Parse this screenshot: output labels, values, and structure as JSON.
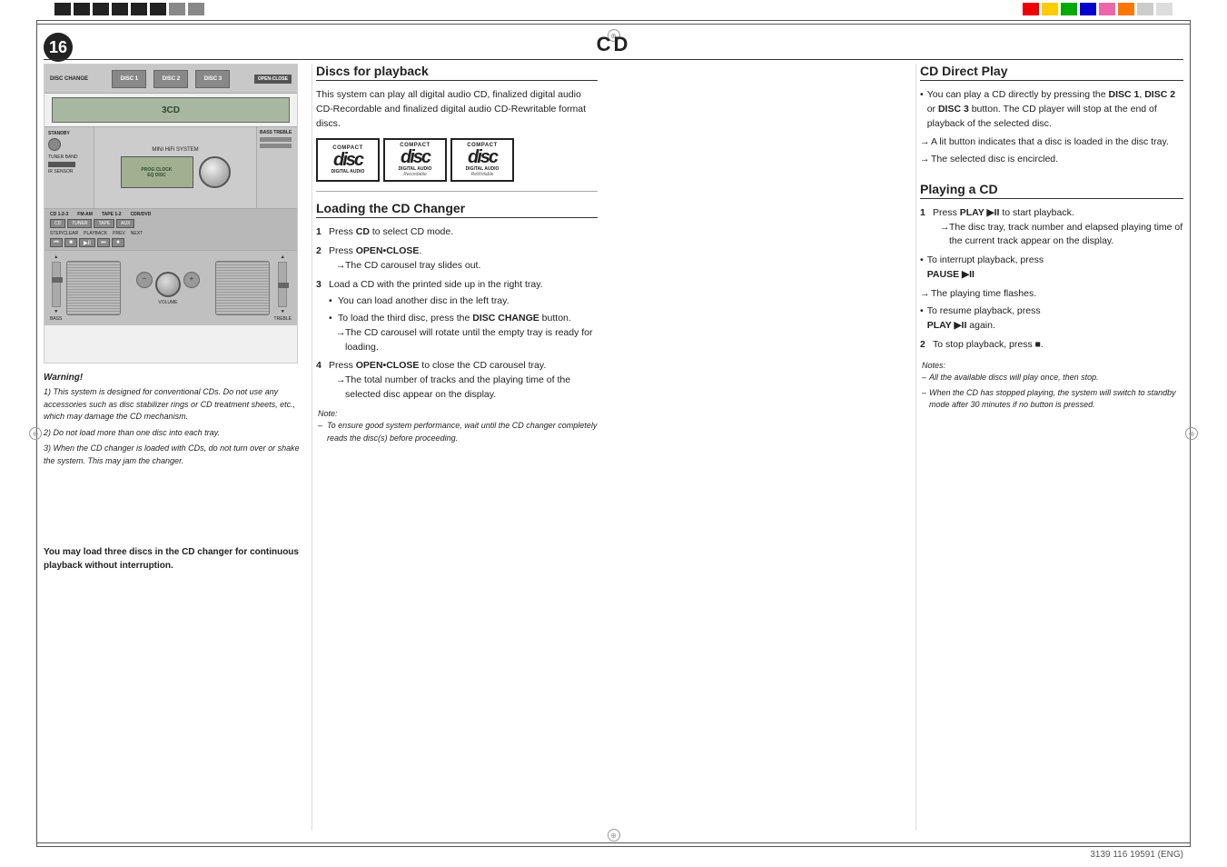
{
  "page": {
    "number": "16",
    "title": "CD",
    "footer": "3139 116 19591 (ENG)"
  },
  "top_bar": {
    "left_squares": [
      "dark",
      "dark",
      "dark",
      "dark",
      "dark",
      "dark",
      "dark",
      "light",
      "light"
    ],
    "right_squares": [
      "red",
      "yellow",
      "green",
      "blue",
      "cyan",
      "pink",
      "orange",
      "lt"
    ]
  },
  "discs_for_playback": {
    "heading": "Discs for playback",
    "body": "This system can play all digital audio CD, finalized digital audio CD-Recordable and finalized digital audio CD-Rewritable format discs.",
    "disc1_top": "COMPACT",
    "disc1_label": "disc",
    "disc1_sub": "DIGITAL AUDIO",
    "disc2_top": "COMPACT",
    "disc2_label": "disc",
    "disc2_sub": "DIGITAL AUDIO",
    "disc2_extra": "Recordable",
    "disc3_top": "COMPACT",
    "disc3_label": "disc",
    "disc3_sub": "DIGITAL AUDIO",
    "disc3_extra": "ReWritable"
  },
  "loading_cd_changer": {
    "heading": "Loading the CD Changer",
    "steps": [
      {
        "num": "1",
        "text": "Press ",
        "bold": "CD",
        "rest": " to select CD mode."
      },
      {
        "num": "2",
        "text": "Press ",
        "bold": "OPEN•CLOSE",
        "rest": ".",
        "arrow": "The CD carousel tray slides out."
      },
      {
        "num": "3",
        "text": "Load a CD with the printed side up in the right tray.",
        "bullet1": "You can load another disc in the left tray.",
        "bullet2": "To load the third disc, press the ",
        "bullet2_bold": "DISC CHANGE",
        "bullet2_rest": " button.",
        "arrow2": "The CD carousel will rotate until the empty tray is ready for loading."
      },
      {
        "num": "4",
        "text": "Press ",
        "bold": "OPEN•CLOSE",
        "rest": " to close the CD carousel tray.",
        "arrow": "The total number of tracks and the playing time of the selected disc appear on the display."
      }
    ],
    "note_label": "Note:",
    "note_text": "To ensure good system performance, wait until the CD changer completely reads the disc(s) before proceeding."
  },
  "cd_direct_play": {
    "heading": "CD Direct Play",
    "bullet1": "You can play a CD directly by pressing the ",
    "bullet1_bold1": "DISC 1",
    "bullet1_mid": ", ",
    "bullet1_bold2": "DISC 2",
    "bullet1_or": " or ",
    "bullet1_bold3": "DISC 3",
    "bullet1_rest": " button. The CD player will stop at the end of playback of the selected disc.",
    "arrow1": "A lit button indicates that a disc is loaded in the disc tray.",
    "arrow2": "The selected disc is encircled."
  },
  "playing_a_cd": {
    "heading": "Playing a CD",
    "step1_text": "Press ",
    "step1_bold": "PLAY ▶II",
    "step1_rest": " to start playback.",
    "step1_arrow": "The disc tray, track number and elapsed playing time of the current track appear on the display.",
    "bullet_interrupt": "To interrupt playback, press",
    "pause_bold": "PAUSE ▶II",
    "pause_arrow": "The playing time flashes.",
    "bullet_resume": "To resume playback, press",
    "play_again_bold": "PLAY ▶II",
    "play_again_rest": " again.",
    "step2_text": "To stop playback, press",
    "step2_symbol": "■",
    "step2_dot": ".",
    "notes_label": "Notes:",
    "note1": "All the available discs will play once, then stop.",
    "note2": "When the CD has stopped playing, the system will switch to standby mode after 30 minutes if no button is pressed."
  },
  "warning": {
    "title": "Warning!",
    "items": [
      "1) This system is designed for conventional CDs. Do not use any accessories such as disc stabilizer rings or CD treatment sheets, etc., which may damage the CD mechanism.",
      "2) Do not load more than one disc into each tray.",
      "3) When the CD changer is loaded with CDs, do not turn over or shake the system. This may jam the changer."
    ]
  },
  "load_text": "You may load three discs in the CD changer for continuous playback without interruption."
}
